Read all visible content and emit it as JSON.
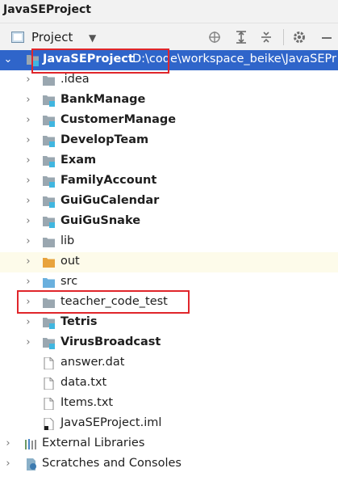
{
  "window": {
    "title": "JavaSEProject"
  },
  "toolbar": {
    "view_label": "Project"
  },
  "tree": {
    "root": {
      "label": "JavaSEProject",
      "path": "D:\\code\\workspace_beike\\JavaSEPr"
    },
    "items": [
      {
        "label": ".idea"
      },
      {
        "label": "BankManage"
      },
      {
        "label": "CustomerManage"
      },
      {
        "label": "DevelopTeam"
      },
      {
        "label": "Exam"
      },
      {
        "label": "FamilyAccount"
      },
      {
        "label": "GuiGuCalendar"
      },
      {
        "label": "GuiGuSnake"
      },
      {
        "label": "lib"
      },
      {
        "label": "out"
      },
      {
        "label": "src"
      },
      {
        "label": "teacher_code_test"
      },
      {
        "label": "Tetris"
      },
      {
        "label": "VirusBroadcast"
      },
      {
        "label": "answer.dat"
      },
      {
        "label": "data.txt"
      },
      {
        "label": "Items.txt"
      },
      {
        "label": "JavaSEProject.iml"
      }
    ],
    "external_libraries": "External Libraries",
    "scratches": "Scratches and Consoles"
  },
  "colors": {
    "selection": "#2f65ca",
    "annotation": "#e0262b",
    "excluded_bg": "#fdfbea"
  }
}
